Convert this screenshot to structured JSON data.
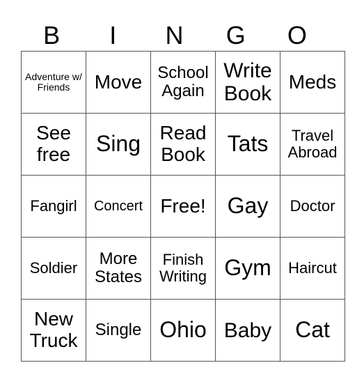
{
  "header": [
    "B",
    "I",
    "N",
    "G",
    "O"
  ],
  "grid": [
    [
      "Adventure w/ Friends",
      "Move",
      "School Again",
      "Write Book",
      "Meds"
    ],
    [
      "See free",
      "Sing",
      "Read Book",
      "Tats",
      "Travel Abroad"
    ],
    [
      "Fangirl",
      "Concert",
      "Free!",
      "Gay",
      "Doctor"
    ],
    [
      "Soldier",
      "More States",
      "Finish Writing",
      "Gym",
      "Haircut"
    ],
    [
      "New Truck",
      "Single",
      "Ohio",
      "Baby",
      "Cat"
    ]
  ]
}
